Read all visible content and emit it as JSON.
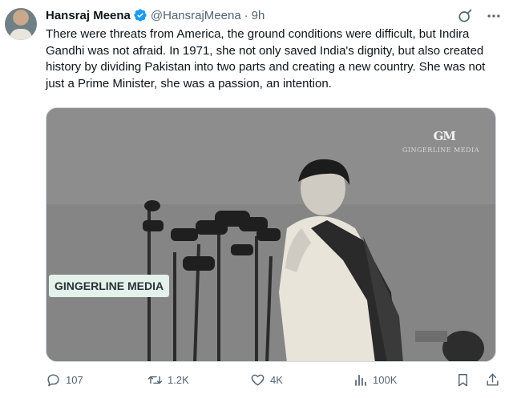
{
  "tweet": {
    "author_name": "Hansraj Meena",
    "handle": "@HansrajMeena",
    "separator": "·",
    "time": "9h",
    "text": "There were threats from America, the ground conditions were difficult, but Indira Gandhi was not afraid. In 1971, she not only saved India's dignity, but also created history by dividing Pakistan into two parts and creating a new country. She was not just a Prime Minister, she was a passion, an intention."
  },
  "media": {
    "logo_text": "GM",
    "logo_subtext": "GINGERLINE MEDIA",
    "watermark": "GINGERLINE MEDIA"
  },
  "stats": {
    "replies": "107",
    "reposts": "1.2K",
    "likes": "4K",
    "views": "100K"
  },
  "colors": {
    "text_primary": "#0f1419",
    "text_secondary": "#536471",
    "verified_blue": "#1d9bf0",
    "watermark_bg": "#e3f2ea"
  },
  "icons": [
    "verified-badge-icon",
    "grok-icon",
    "more-icon",
    "reply-icon",
    "repost-icon",
    "like-icon",
    "views-icon",
    "bookmark-icon",
    "share-icon"
  ]
}
